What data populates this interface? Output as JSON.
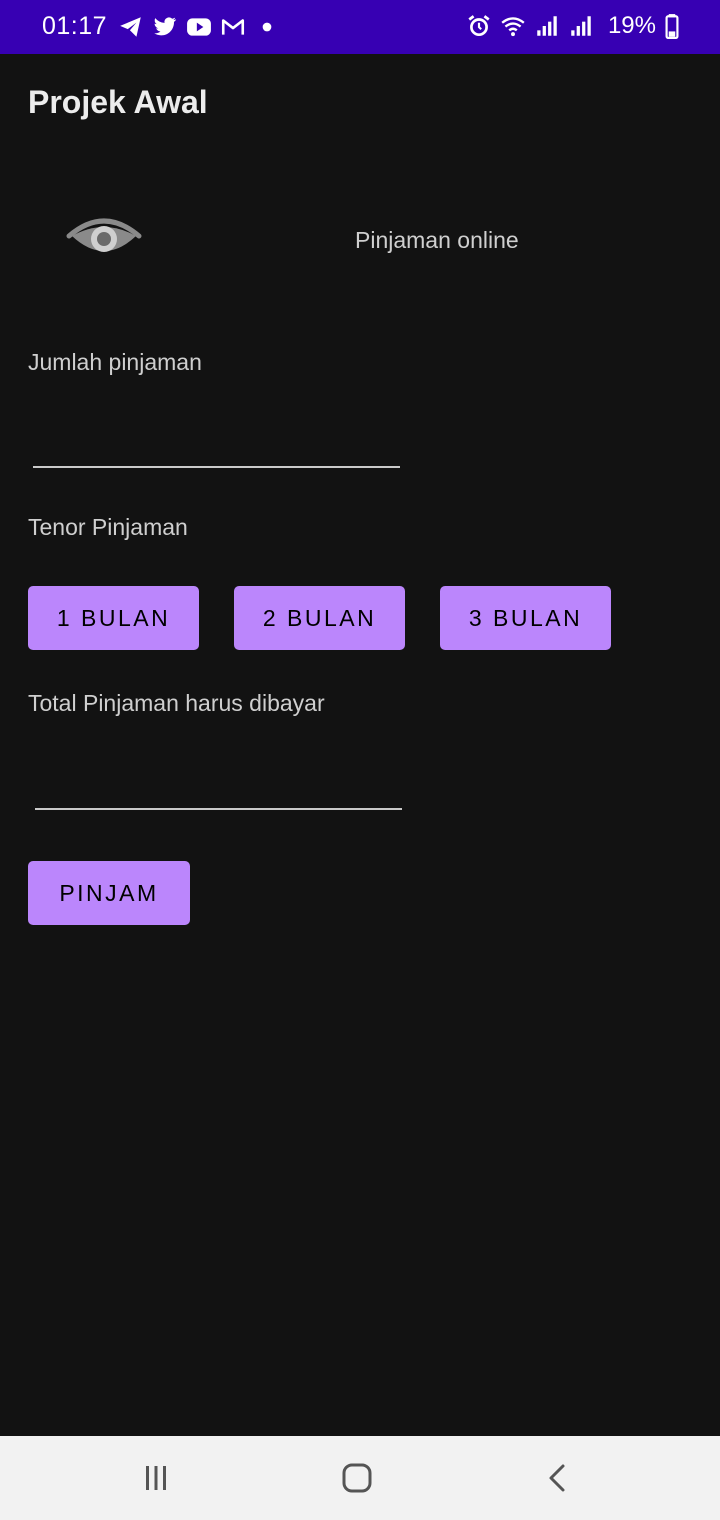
{
  "status_bar": {
    "time": "01:17",
    "battery": "19%",
    "left_icons": [
      "telegram-icon",
      "twitter-icon",
      "youtube-icon",
      "gmail-icon",
      "dot-icon"
    ],
    "right_icons": [
      "alarm-icon",
      "wifi-icon",
      "signal-icon",
      "signal-icon",
      "battery-icon"
    ]
  },
  "app_bar": {
    "title": "Projek Awal"
  },
  "header": {
    "icon": "eye-icon",
    "text": "Pinjaman online"
  },
  "form": {
    "amount_label": "Jumlah pinjaman",
    "amount_value": "",
    "tenor_label": "Tenor Pinjaman",
    "tenor_options": [
      "1 BULAN",
      "2 BULAN",
      "3 BULAN"
    ],
    "total_label": "Total Pinjaman harus dibayar",
    "total_value": "",
    "submit_label": "PINJAM"
  },
  "colors": {
    "status_bar": "#3700B3",
    "background": "#121212",
    "button": "#BB86FC",
    "nav_bar": "#f2f2f2"
  },
  "nav_bar": {
    "buttons": [
      "recents-icon",
      "home-icon",
      "back-icon"
    ]
  }
}
